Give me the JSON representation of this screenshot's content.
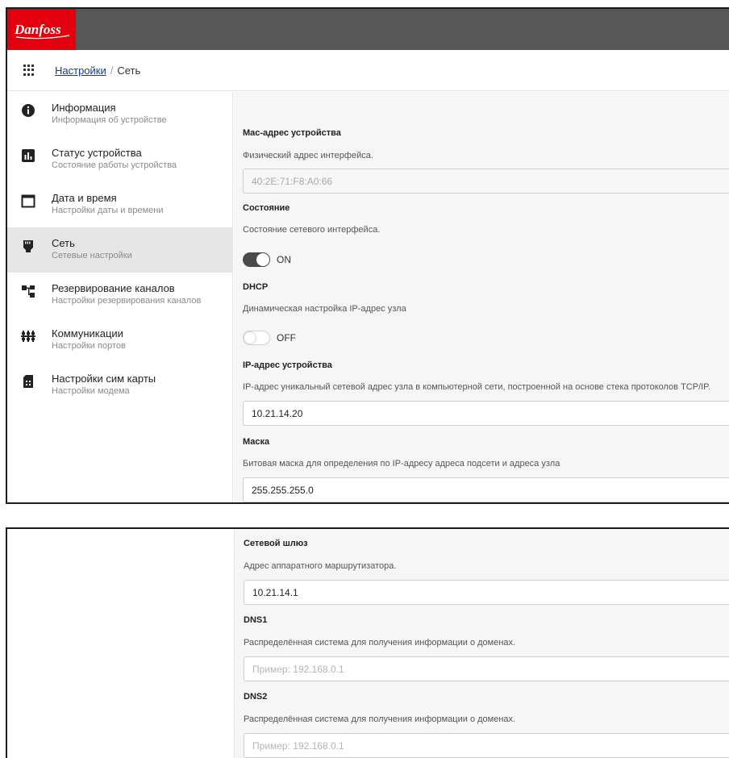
{
  "brand": {
    "logo_text": "Danfoss",
    "logo_color": "#e2000f"
  },
  "breadcrumb": {
    "parent": "Настройки",
    "separator": "/",
    "current": "Сеть"
  },
  "sidebar": {
    "items": [
      {
        "title": "Информация",
        "subtitle": "Информация об устройстве",
        "icon": "info-icon"
      },
      {
        "title": "Статус устройства",
        "subtitle": "Состояние работы устройства",
        "icon": "bar-chart-icon"
      },
      {
        "title": "Дата и время",
        "subtitle": "Настройки даты и времени",
        "icon": "calendar-icon"
      },
      {
        "title": "Сеть",
        "subtitle": "Сетевые настройки",
        "icon": "ethernet-icon",
        "active": true
      },
      {
        "title": "Резервирование каналов",
        "subtitle": "Настройки резервирования каналов",
        "icon": "hierarchy-icon"
      },
      {
        "title": "Коммуникации",
        "subtitle": "Настройки портов",
        "icon": "ports-icon"
      },
      {
        "title": "Настройки сим карты",
        "subtitle": "Настройки модема",
        "icon": "sim-card-icon"
      }
    ]
  },
  "network": {
    "mac": {
      "label": "Mac-адрес устройства",
      "description": "Физический адрес интерфейса.",
      "value": "40:2E:71:F8:A0:66"
    },
    "state": {
      "label": "Состояние",
      "description": "Состояние сетевого интерфейса.",
      "toggle_text": "ON",
      "on": true
    },
    "dhcp": {
      "label": "DHCP",
      "description": "Динамическая настройка IP-адрес узла",
      "toggle_text": "OFF",
      "on": false
    },
    "ip": {
      "label": "IP-адрес устройства",
      "description": "IP-адрес уникальный сетевой адрес узла в компьютерной сети, построенной на основе стека протоколов TCP/IP.",
      "value": "10.21.14.20"
    },
    "mask": {
      "label": "Маска",
      "description": "Битовая маска для определения по IP-адресу адреса подсети и адреса узла",
      "value": "255.255.255.0"
    },
    "gateway": {
      "label": "Сетевой шлюз",
      "description": "Адрес аппаратного маршрутизатора.",
      "value": "10.21.14.1"
    },
    "dns1": {
      "label": "DNS1",
      "description": "Распределённая система для получения информации о доменах.",
      "placeholder": "Пример: 192.168.0.1"
    },
    "dns2": {
      "label": "DNS2",
      "description": "Распределённая система для получения информации о доменах.",
      "placeholder": "Пример: 192.168.0.1"
    }
  }
}
